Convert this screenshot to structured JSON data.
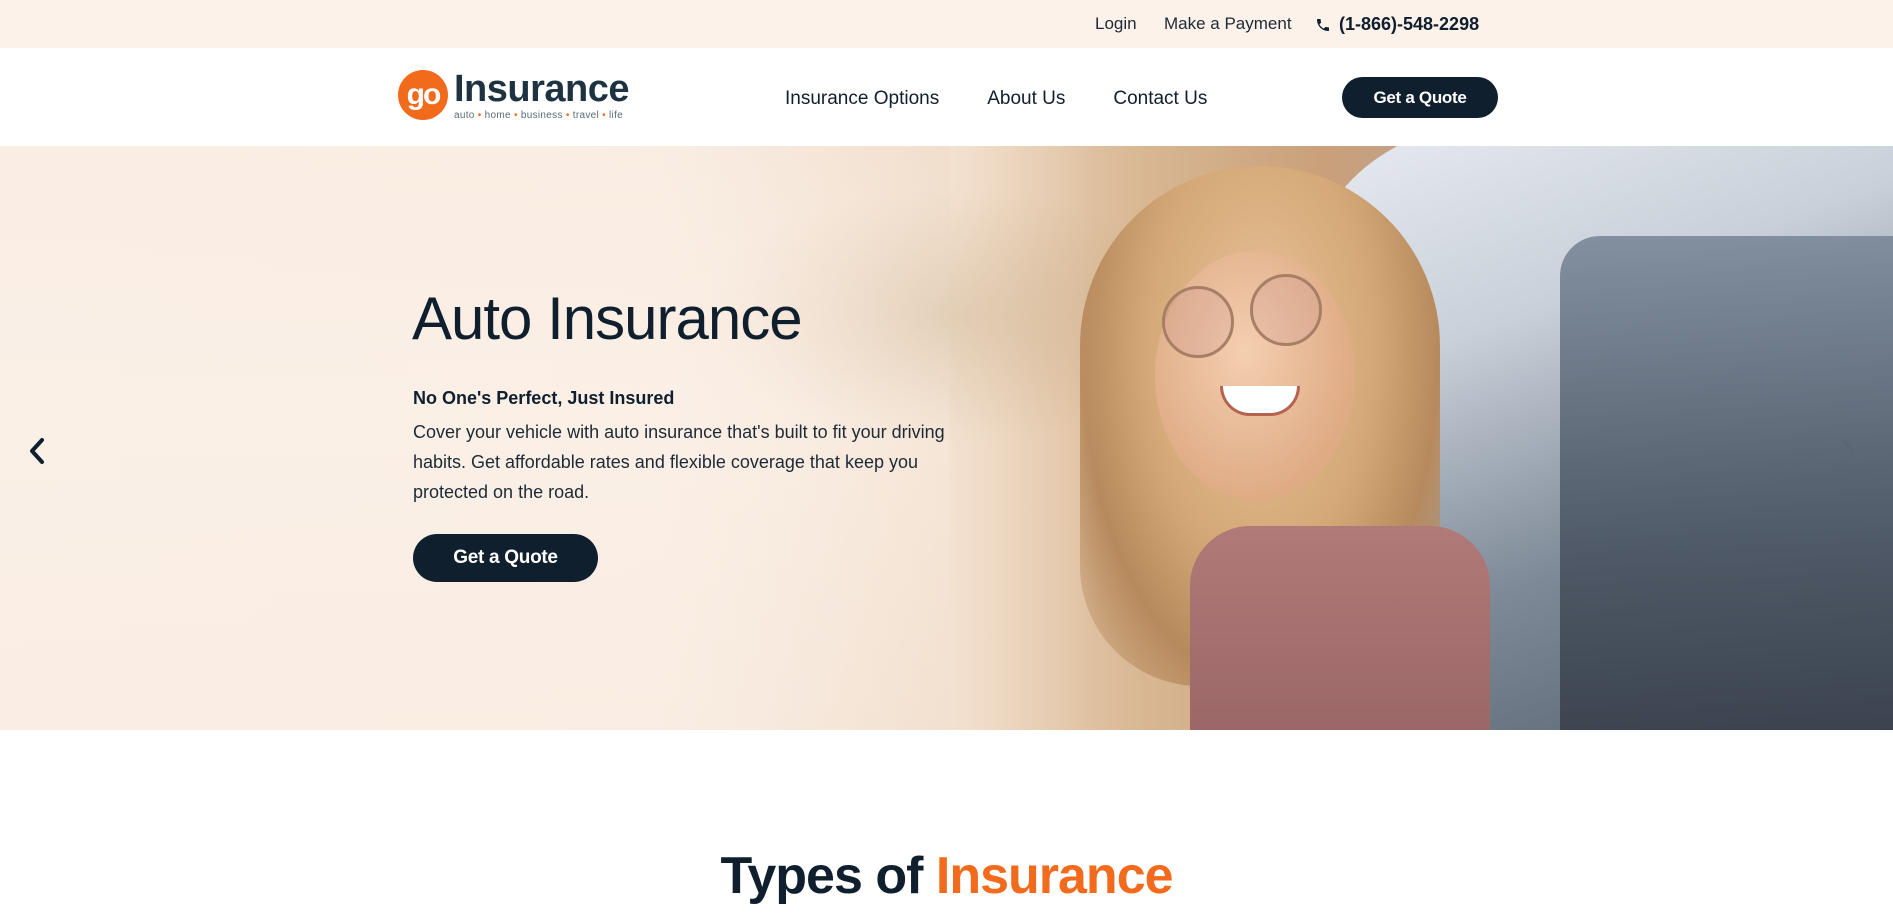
{
  "topbar": {
    "login": "Login",
    "payment": "Make a Payment",
    "phone": "(1-866)-548-2298"
  },
  "header": {
    "logo": {
      "mark": "go",
      "word": "Insurance",
      "tagline": [
        "auto",
        "home",
        "business",
        "travel",
        "life"
      ]
    },
    "nav": [
      "Insurance Options",
      "About Us",
      "Contact Us"
    ],
    "quote_button": "Get a Quote"
  },
  "hero": {
    "title": "Auto Insurance",
    "subtitle": "No One's Perfect, Just Insured",
    "description": "Cover your vehicle with auto insurance that's built to fit your driving habits. Get affordable rates and flexible coverage that keep you protected on the road.",
    "cta": "Get a Quote"
  },
  "section": {
    "title_part1": "Types of ",
    "title_accent": "Insurance"
  },
  "colors": {
    "accent": "#f26a1b",
    "dark": "#0f1f2e",
    "topbar_bg": "#fdf2ea"
  },
  "icons": {
    "phone": "phone-icon",
    "prev": "chevron-left-icon",
    "next": "chevron-right-icon"
  }
}
